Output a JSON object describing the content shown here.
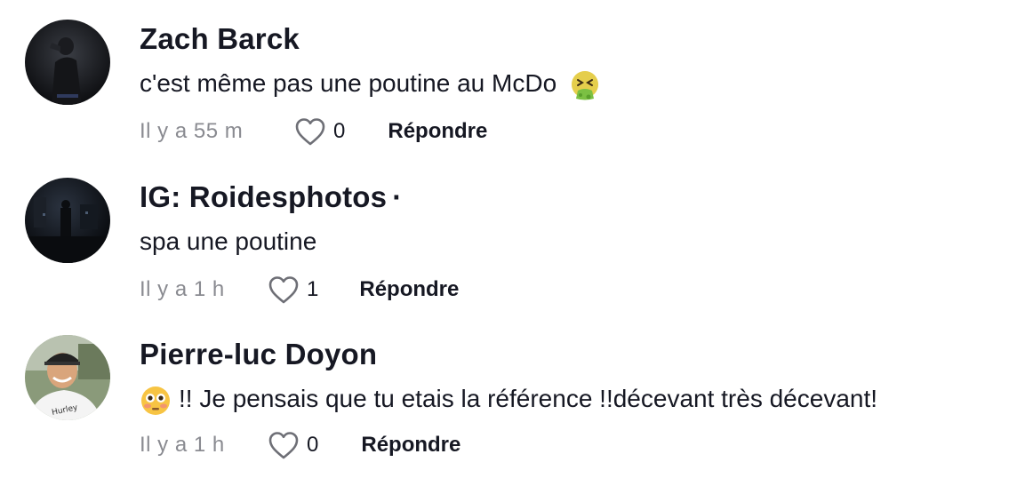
{
  "comments": [
    {
      "author": "Zach Barck",
      "text": "c'est même pas une poutine au McDo",
      "text_emoji": "nauseated-vomiting-face-emoji",
      "time": "Il y a 55 m",
      "likes": "0",
      "reply_label": "Répondre",
      "avatar": "dark-photo-person-avatar"
    },
    {
      "author": "IG: Roidesphotos",
      "author_suffix": "·",
      "text": "spa une poutine",
      "time": "Il y a 1 h",
      "likes": "1",
      "reply_label": "Répondre",
      "avatar": "dark-night-street-avatar"
    },
    {
      "author": "Pierre-luc Doyon",
      "text_emoji": "flushed-face-emoji",
      "text": "!! Je pensais que tu etais la référence !!décevant très décevant!",
      "time": "Il y a 1 h",
      "likes": "0",
      "reply_label": "Répondre",
      "avatar": "man-with-cap-selfie-avatar"
    }
  ],
  "colors": {
    "text": "#161823",
    "meta": "#8a8b91",
    "background": "#ffffff"
  }
}
